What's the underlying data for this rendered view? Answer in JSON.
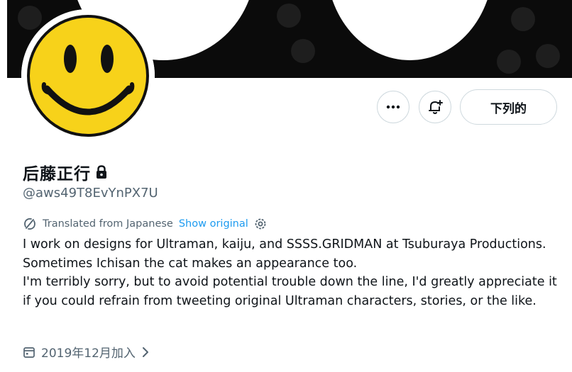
{
  "profile": {
    "display_name": "后藤正行",
    "handle": "@aws49T8EvYnPX7U",
    "joined": "2019年12月加入",
    "protected_icon": "lock-icon"
  },
  "actions": {
    "more_icon": "more-horizontal-icon",
    "subscribe_icon": "notification-bell-plus-icon",
    "follow_label": "下列的"
  },
  "translation": {
    "label": "Translated from Japanese",
    "show_original": "Show original",
    "icon": "translate-icon",
    "settings_icon": "settings-gear-icon"
  },
  "bio": {
    "line1": "I work on designs for Ultraman, kaiju, and SSSS.GRIDMAN at Tsuburaya Productions. Sometimes Ichisan the cat makes an appearance too.",
    "line2": "I'm terribly sorry, but to avoid potential trouble down the line, I'd greatly appreciate it if you could refrain from tweeting original Ultraman characters, stories, or the like."
  },
  "colors": {
    "link": "#1d9bf0",
    "secondary_text": "#536471",
    "primary_text": "#0f1419",
    "avatar_yellow": "#f7d21a",
    "banner": "#0b0b0b"
  }
}
